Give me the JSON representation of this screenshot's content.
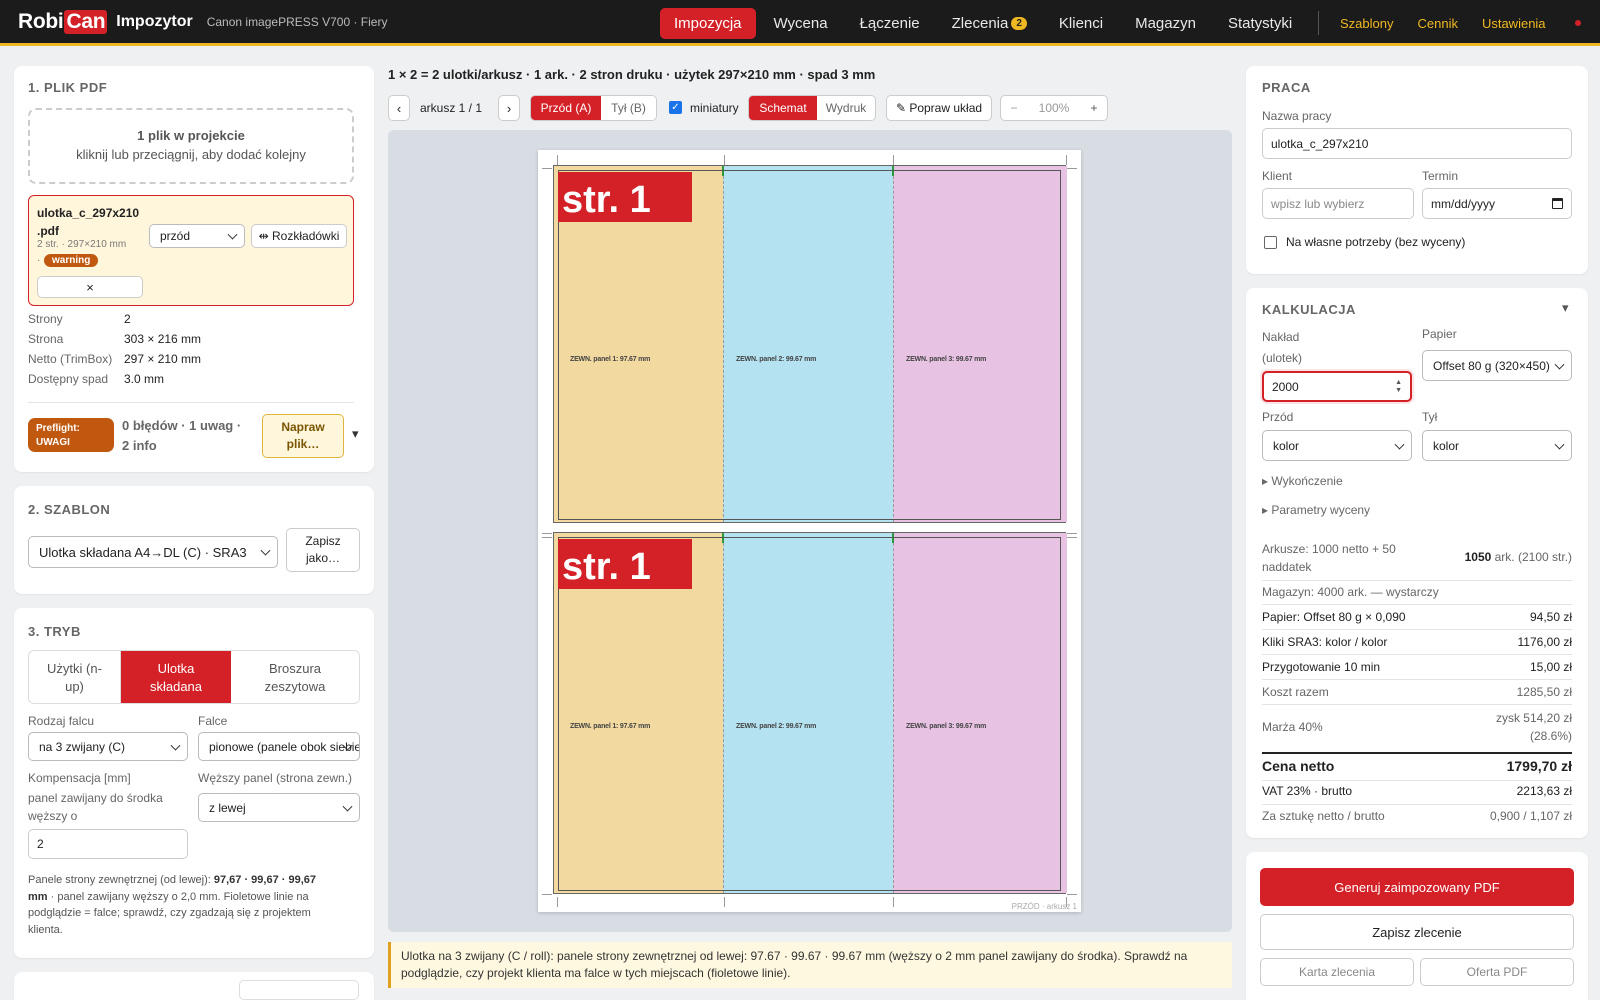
{
  "header": {
    "logo_a": "Robi",
    "logo_b": "Can",
    "app_name": "Impozytor",
    "device": "Canon imagePRESS V700 · Fiery",
    "nav": [
      {
        "label": "Impozycja",
        "active": true
      },
      {
        "label": "Wycena"
      },
      {
        "label": "Łączenie"
      },
      {
        "label": "Zlecenia",
        "badge": "2"
      },
      {
        "label": "Klienci"
      },
      {
        "label": "Magazyn"
      },
      {
        "label": "Statystyki"
      }
    ],
    "right_links": [
      "Szablony",
      "Cennik",
      "Ustawienia"
    ]
  },
  "pdf": {
    "title": "1. PLIK PDF",
    "drop_line1": "1 plik w projekcie",
    "drop_line2": "kliknij lub przeciągnij, aby dodać kolejny",
    "file_name_1": "ulotka_c_297x210",
    "file_name_2": ".pdf",
    "file_meta": "2 str. · 297×210 mm",
    "file_meta_dot": "·",
    "warning_badge": "warning",
    "side_select": "przód",
    "spreads_button": "⇹ Rozkładówki",
    "remove_button": "×",
    "info": [
      {
        "k": "Strony",
        "v": "2"
      },
      {
        "k": "Strona",
        "v": "303 × 216 mm"
      },
      {
        "k": "Netto (TrimBox)",
        "v": "297 × 210 mm"
      },
      {
        "k": "Dostępny spad",
        "v": "3.0 mm"
      }
    ],
    "preflight_badge_1": "Preflight:",
    "preflight_badge_2": "UWAGI",
    "preflight_summary_1": "0 błędów · 1 uwag ·",
    "preflight_summary_2": "2 info",
    "fix_button_1": "Napraw",
    "fix_button_2": "plik…",
    "expand": "▾"
  },
  "template": {
    "title": "2. SZABLON",
    "selected": "Ulotka składana A4→DL (C) · SRA3",
    "save_1": "Zapisz",
    "save_2": "jako…"
  },
  "mode": {
    "title": "3. TRYB",
    "tabs": [
      {
        "l1": "Użytki (n-",
        "l2": "up)"
      },
      {
        "l1": "Ulotka",
        "l2": "składana",
        "active": true
      },
      {
        "l1": "Broszura",
        "l2": "zeszytowa"
      }
    ],
    "fold_type_label": "Rodzaj falcu",
    "fold_type": "na 3 zwijany (C)",
    "folds_label": "Falce",
    "folds": "pionowe (panele obok siebie)",
    "comp_label": "Kompensacja [mm]",
    "comp_desc_1": "panel zawijany do środka",
    "comp_desc_2": "węższy o",
    "comp_value": "2",
    "narrow_label": "Węższy panel (strona zewn.)",
    "narrow_value": "z lewej",
    "note_1_a": "Panele strony zewnętrznej (od lewej): ",
    "note_1_b": "97,67 · 99,67 · 99,67",
    "note_2_a": "mm",
    "note_2_b": " · panel zawijany węższy o 2,0 mm. Fioletowe linie na",
    "note_3": "podglądzie = falce; sprawdź, czy zgadzają się z projektem",
    "note_4": "klienta."
  },
  "preview": {
    "summary": "1 × 2 = 2 ulotki/arkusz · 1 ark. · 2 stron druku · użytek 297×210 mm · spad 3 mm",
    "prev": "‹",
    "sheet": "arkusz 1 / 1",
    "next": "›",
    "front": "Przód (A)",
    "back": "Tył (B)",
    "thumbnails": "miniatury",
    "schema": "Schemat",
    "print": "Wydruk",
    "fix_layout": "✎ Popraw układ",
    "zoom_minus": "−",
    "zoom": "100%",
    "zoom_plus": "+",
    "page_label": "str. 1",
    "panel_labels": [
      "ZEWN. panel 1: 97.67 mm",
      "ZEWN. panel 2: 99.67 mm",
      "ZEWN. panel 3: 99.67 mm"
    ],
    "sheet_footer": "PRZÓD · arkusz 1",
    "notice_1": "Ulotka na 3 zwijany (C / roll): panele strony zewnętrznej od lewej: 97.67 · 99.67 · 99.67 mm (węższy o 2 mm panel zawijany do środka). Sprawdź na",
    "notice_2": "podglądzie, czy projekt klienta ma falce w tych miejscach (fioletowe linie)."
  },
  "job": {
    "title": "PRACA",
    "name_label": "Nazwa pracy",
    "name_value": "ulotka_c_297x210",
    "client_label": "Klient",
    "client_placeholder": "wpisz lub wybierz",
    "due_label": "Termin",
    "due_placeholder": "mm/dd/yyyy",
    "own_needs": "Na własne potrzeby (bez wyceny)"
  },
  "calc": {
    "title": "KALKULACJA",
    "collapse": "▾",
    "qty_label_1": "Nakład",
    "qty_label_2": "(ulotek)",
    "qty_value": "2000",
    "paper_label": "Papier",
    "paper_value": "Offset 80 g (320×450)",
    "front_label": "Przód",
    "front_value": "kolor",
    "back_label": "Tył",
    "back_value": "kolor",
    "finishing": "▸ Wykończenie",
    "params": "▸ Parametry wyceny",
    "sheets_label_1": "Arkusze: 1000 netto + 50",
    "sheets_label_2": "naddatek",
    "sheets_value_bold": "1050",
    "sheets_value_rest": " ark. (2100 str.)",
    "stock": "Magazyn: 4000 ark. — wystarczy",
    "lines": [
      {
        "k": "Papier: Offset 80 g × 0,090",
        "v": "94,50 zł"
      },
      {
        "k": "Kliki SRA3: kolor / kolor",
        "v": "1176,00 zł"
      },
      {
        "k": "Przygotowanie 10 min",
        "v": "15,00 zł"
      }
    ],
    "total_cost_label": "Koszt razem",
    "total_cost": "1285,50 zł",
    "margin_label": "Marża 40%",
    "margin_1": "zysk 514,20 zł",
    "margin_2": "(28.6%)",
    "net_label": "Cena netto",
    "net_value": "1799,70 zł",
    "vat_label": "VAT 23% · brutto",
    "vat_value": "2213,63 zł",
    "unit_label": "Za sztukę netto / brutto",
    "unit_value": "0,900 / 1,107 zł"
  },
  "actions": {
    "generate": "Generuj zaimpozowany PDF",
    "save_order": "Zapisz zlecenie",
    "order_card": "Karta zlecenia",
    "offer_pdf": "Oferta PDF"
  },
  "colors": {
    "accent": "#d42027",
    "gold": "#f0b820",
    "panel1": "#f2d9a0",
    "panel2": "#b4e2f0",
    "panel3": "#e7c2e3"
  }
}
